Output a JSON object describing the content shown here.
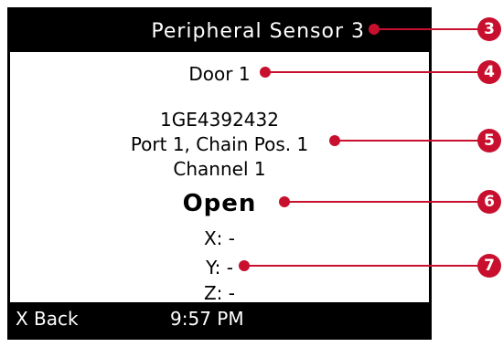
{
  "device": {
    "title": "Peripheral Sensor 3",
    "sensor_name": "Door 1",
    "serial": "1GE4392432",
    "port_chain": "Port 1, Chain Pos. 1",
    "channel": "Channel 1",
    "status": "Open",
    "axes": {
      "x": "X: -",
      "y": "Y: -",
      "z": "Z: -"
    },
    "back_label": "X Back",
    "time": "9:57 PM"
  },
  "callouts": [
    {
      "number": "3",
      "target": "title"
    },
    {
      "number": "4",
      "target": "sensor_name"
    },
    {
      "number": "5",
      "target": "port_chain"
    },
    {
      "number": "6",
      "target": "status"
    },
    {
      "number": "7",
      "target": "axes"
    }
  ],
  "colors": {
    "callout": "#c8102e",
    "screen_bg": "#ffffff",
    "bar_bg": "#000000"
  }
}
